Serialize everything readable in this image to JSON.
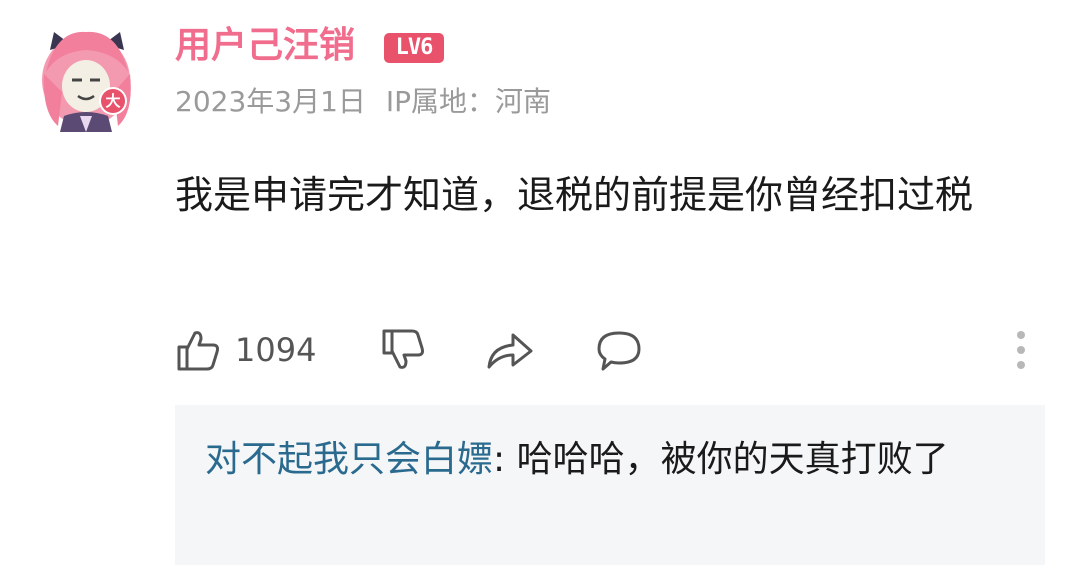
{
  "comment": {
    "username": "用户己汪销",
    "level_badge": "LV6",
    "avatar_badge": "大",
    "date": "2023年3月1日",
    "ip_location": "IP属地：河南",
    "text": "我是申请完才知道，退税的前提是你曾经扣过税",
    "like_count": "1094"
  },
  "icons": {
    "like": "thumbs-up-icon",
    "dislike": "thumbs-down-icon",
    "share": "share-icon",
    "reply": "comment-bubble-icon",
    "more": "more-vertical-icon"
  },
  "reply": {
    "author": "对不起我只会白嫖",
    "separator": ":",
    "text": " 哈哈哈，被你的天真打败了"
  },
  "colors": {
    "username": "#f06d8d",
    "level_badge": "#e8526b",
    "reply_author": "#2b6a8f",
    "reply_background": "#f5f6f8",
    "meta_text": "#9a9a9a"
  }
}
